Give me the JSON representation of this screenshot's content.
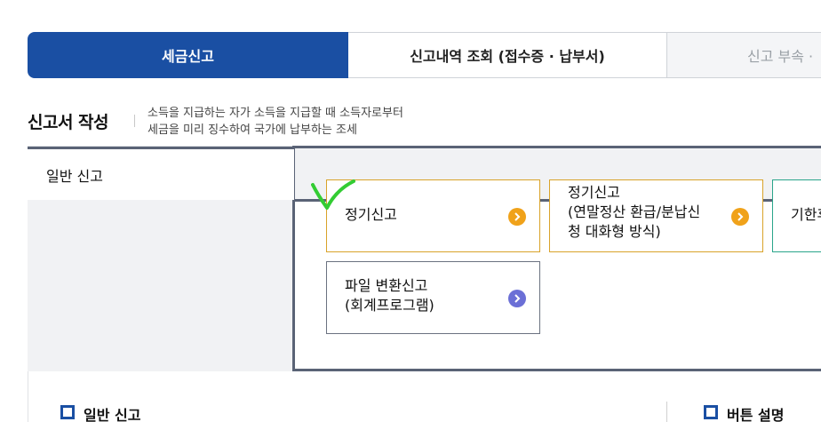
{
  "tabs": [
    {
      "label": "세금신고",
      "state": "active"
    },
    {
      "label": "신고내역 조회 (접수증 · 납부서)",
      "state": "normal"
    },
    {
      "label": "신고 부속 ·",
      "state": "disabled"
    }
  ],
  "section": {
    "title": "신고서 작성",
    "desc_line1": "소득을 지급하는 자가 소득을 지급할 때 소득자로부터",
    "desc_line2": "세금을 미리 징수하여 국가에 납부하는 조세"
  },
  "panel": {
    "general_tab_label": "일반 신고",
    "options": [
      {
        "line1": "정기신고",
        "line2": "",
        "line3": "",
        "arrow_color": "#f0a21a"
      },
      {
        "line1": "정기신고",
        "line2": "(연말정산 환급/분납신",
        "line3": "청 대화형 방식)",
        "arrow_color": "#f0a21a"
      },
      {
        "line1": "기한후",
        "line2": "",
        "line3": ""
      },
      {
        "line1": "파일 변환신고",
        "line2": "(회계프로그램)",
        "line3": "",
        "arrow_color": "#6b6fd6"
      }
    ]
  },
  "bottom": {
    "left_title": "일반 신고",
    "right_title": "버튼 설명"
  },
  "colors": {
    "primary": "#1a4fa3",
    "panel_border": "#5a6376",
    "card_orange": "#d9a32a",
    "card_teal": "#2aa58a",
    "check_green": "#33cc33"
  }
}
